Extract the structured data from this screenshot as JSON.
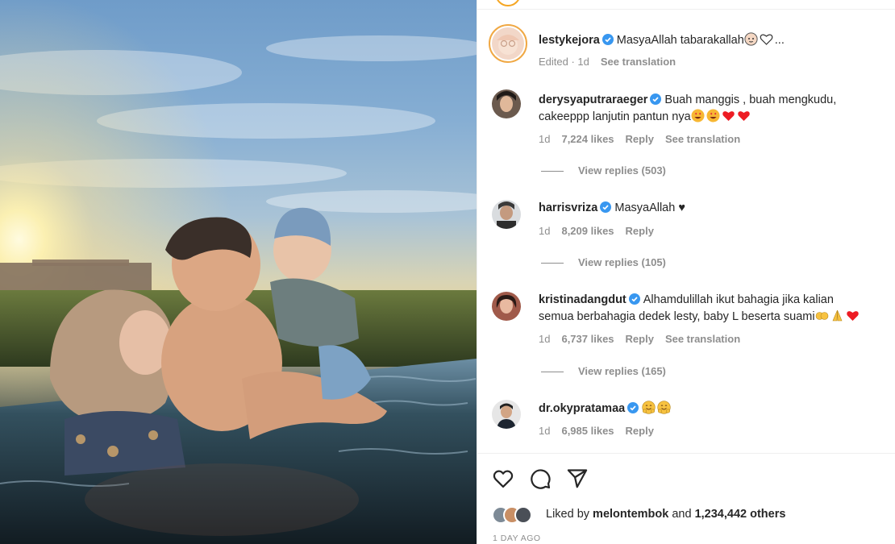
{
  "post": {
    "photo_alt": "Family in infinity pool at sunset",
    "caption": {
      "username": "lestykejora",
      "text": "MasyaAllah tabarakallah",
      "emoji": [
        "baby-face",
        "white-heart"
      ],
      "ellipsis": "...",
      "meta_edited": "Edited · 1d",
      "meta_translate": "See translation"
    },
    "comments": [
      {
        "username": "derysyaputraraeger",
        "verified": true,
        "text_line1": "Buah manggis , buah mengkudu,",
        "text_line2": "cakeeppp lanjutin pantun nya",
        "emoji": [
          "heart-eyes",
          "heart-eyes",
          "red-heart",
          "red-heart"
        ],
        "age": "1d",
        "likes": "7,224 likes",
        "reply": "Reply",
        "translate": "See translation",
        "view_replies": "View replies (503)"
      },
      {
        "username": "harrisvriza",
        "verified": true,
        "text_line1": "MasyaAllah ♥",
        "age": "1d",
        "likes": "8,209 likes",
        "reply": "Reply",
        "view_replies": "View replies (105)"
      },
      {
        "username": "kristinadangdut",
        "verified": true,
        "text_line1": "Alhamdulillah ikut bahagia jika kalian",
        "text_line2": "semua berbahagia dedek lesty, baby L beserta suami",
        "emoji": [
          "hugging-hands",
          "folded-hands",
          "red-heart"
        ],
        "age": "1d",
        "likes": "6,737 likes",
        "reply": "Reply",
        "translate": "See translation",
        "view_replies": "View replies (165)"
      },
      {
        "username": "dr.okypratamaa",
        "verified": true,
        "text_line1": "",
        "emoji": [
          "hugging-face",
          "hugging-face"
        ],
        "age": "1d",
        "likes": "6,985 likes",
        "reply": "Reply"
      }
    ],
    "actions": {
      "icons": [
        "heart-icon",
        "comment-icon",
        "share-icon"
      ]
    },
    "liked_by": {
      "prefix": "Liked by",
      "user": "melontembok",
      "and": "and",
      "others": "1,234,442 others"
    },
    "time_ago": "1 DAY AGO"
  },
  "colors": {
    "text": "#262626",
    "muted": "#8e8e8e",
    "verified": "#3897f0",
    "red_heart": "#ed1c24"
  }
}
